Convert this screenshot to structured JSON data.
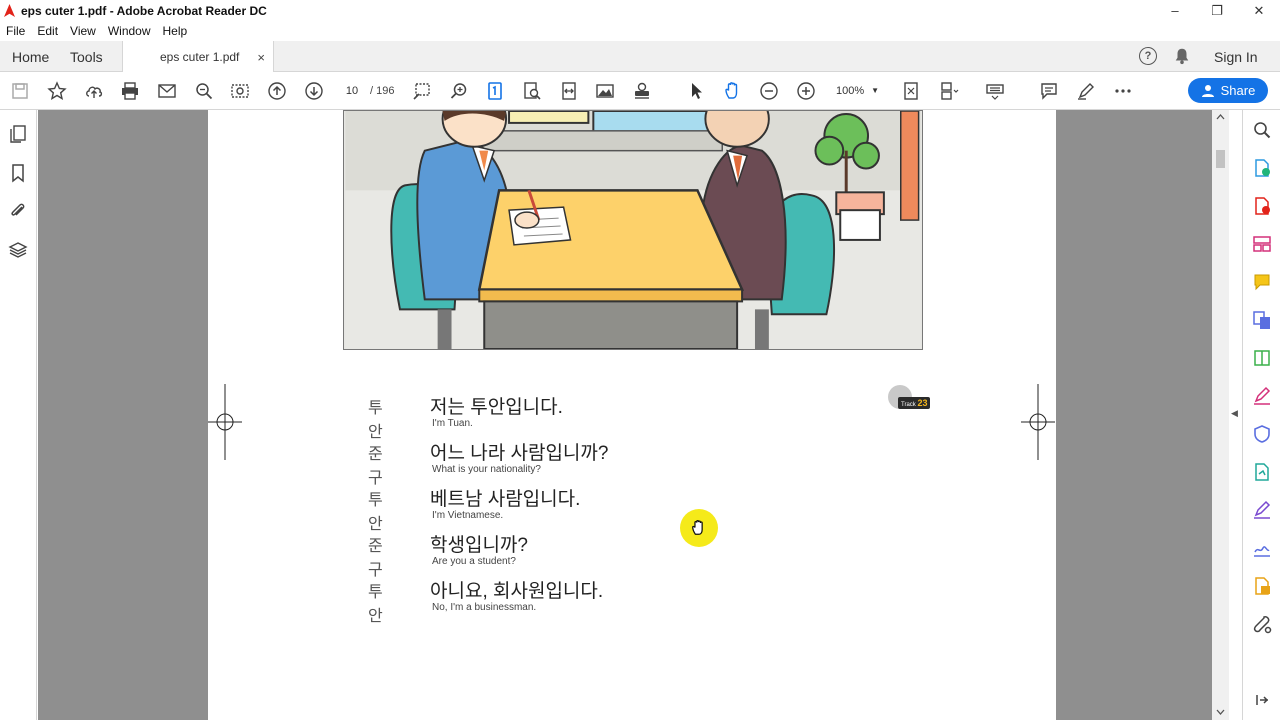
{
  "window": {
    "title": "eps cuter 1.pdf - Adobe Acrobat Reader DC",
    "minimize": "–",
    "maximize": "❐",
    "close": "✕"
  },
  "menu": [
    "File",
    "Edit",
    "View",
    "Window",
    "Help"
  ],
  "tabs": {
    "home": "Home",
    "tools": "Tools",
    "document": "eps cuter 1.pdf",
    "close": "×"
  },
  "header": {
    "help": "?",
    "sign_in": "Sign In"
  },
  "toolbar": {
    "page_current": "10",
    "page_total": "/ 196",
    "zoom": "100%",
    "zoom_caret": "▼",
    "share": "Share"
  },
  "panels": {
    "left_collapse": "◀",
    "right_collapse": "◀"
  },
  "document": {
    "track_label": "Track",
    "track_number": "23",
    "dialogue": [
      {
        "speaker": "투 안",
        "korean": "저는 투안입니다.",
        "english": "I'm Tuan."
      },
      {
        "speaker": "준 구",
        "korean": "어느 나라 사람입니까?",
        "english": "What is your nationality?"
      },
      {
        "speaker": "투 안",
        "korean": "베트남 사람입니다.",
        "english": "I'm Vietnamese."
      },
      {
        "speaker": "준 구",
        "korean": "학생입니까?",
        "english": "Are you a student?"
      },
      {
        "speaker": "투 안",
        "korean": "아니요, 회사원입니다.",
        "english": "No, I'm a businessman."
      }
    ]
  },
  "colors": {
    "accent": "#1473e6",
    "tool_active": "#1473e6",
    "cursor_highlight": "#f5ea1a"
  }
}
